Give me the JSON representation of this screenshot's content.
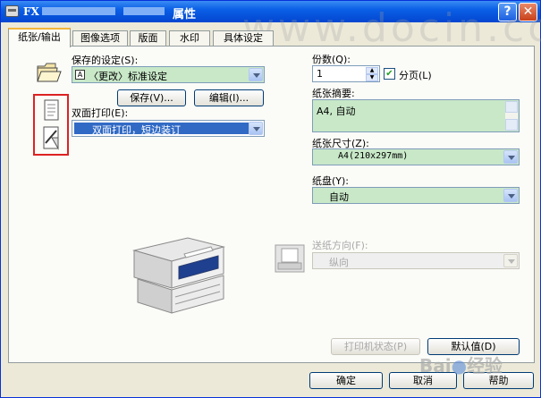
{
  "window": {
    "brand": "FX",
    "title": "属性",
    "help_label": "?",
    "close_label": "✕"
  },
  "tabs": [
    "纸张/输出",
    "图像选项",
    "版面",
    "水印",
    "具体设定"
  ],
  "saved_settings": {
    "label": "保存的设定(S):",
    "value": "〈更改〉标准设定",
    "save_button": "保存(V)...",
    "edit_button": "编辑(I)..."
  },
  "duplex": {
    "label": "双面打印(E):",
    "value": "双面打印，短边装订"
  },
  "copies": {
    "label": "份数(Q):",
    "value": "1",
    "collate_label": "分页(L)",
    "collate_checked": true
  },
  "summary": {
    "label": "纸张摘要:",
    "value": "A4, 自动"
  },
  "paper_size": {
    "label": "纸张尺寸(Z):",
    "value": "A4(210x297mm)"
  },
  "tray": {
    "label": "纸盘(Y):",
    "value": "自动"
  },
  "feed_direction": {
    "label": "送纸方向(F):",
    "value": "纵向"
  },
  "buttons": {
    "printer_status": "打印机状态(P)",
    "defaults": "默认值(D)",
    "ok": "确定",
    "cancel": "取消",
    "help": "帮助"
  },
  "watermark": "www.docin.com",
  "colors": {
    "title_bar": "#0a5fe6",
    "panel_bg": "#fbfbf8",
    "input_bg": "#c8e8c8",
    "highlight": "#316ac5",
    "red_frame": "#dd2222"
  }
}
